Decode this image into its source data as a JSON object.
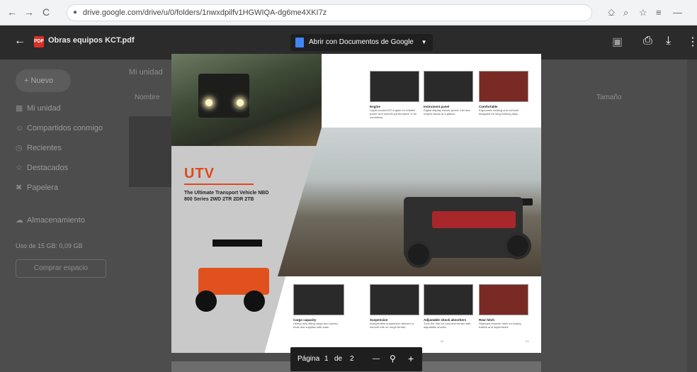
{
  "browser": {
    "back_icon": "←",
    "forward_icon": "→",
    "reload_icon": "C",
    "url": "drive.google.com/drive/u/0/folders/1nwxdpilfv1HGWIQA-dg6me4XKI7z",
    "lock_icon": "lock-icon",
    "extensions": [
      "⎐",
      "⌕",
      "☆",
      "≡",
      "—"
    ]
  },
  "viewer": {
    "file_name": "Obras equipos KCT.pdf",
    "open_with_label": "Abrir con Documentos de Google",
    "back_icon": "←",
    "toolbar_icons": [
      "add-to-drive-icon",
      "print-icon",
      "download-icon",
      "more-icon"
    ]
  },
  "drive": {
    "new_label": "Nuevo",
    "nav_items": [
      {
        "icon": "▦",
        "label": "Mi unidad"
      },
      {
        "icon": "☺",
        "label": "Compartidos conmigo"
      },
      {
        "icon": "◷",
        "label": "Recientes"
      },
      {
        "icon": "☆",
        "label": "Destacados"
      },
      {
        "icon": "✖",
        "label": "Papelera"
      }
    ],
    "storage_label": "Almacenamiento",
    "storage_used": "Uso de 15 GB: 0,09 GB",
    "storage_button": "Comprar espacio",
    "column_header_a": "Mi unidad",
    "column_header_b": "Nombre",
    "column_header_c": "Tamaño"
  },
  "brochure": {
    "title": "UTV",
    "subtitle": "The Ultimate Transport Vehicle NBD 800 Series 2WD 2TR 2DR 2TB",
    "top_captions": [
      {
        "head": "Engine",
        "text": "Liquid-cooled EFI engine for reliable power and smooth performance in all conditions."
      },
      {
        "head": "Instrument panel",
        "text": "Digital display shows speed, fuel and engine status at a glance."
      },
      {
        "head": "Comfortable",
        "text": "Ergonomic seating and controls designed for long working days."
      }
    ],
    "bottom_captions": [
      {
        "head": "Cargo capacity",
        "text": "Heavy-duty tilting cargo bed carries tools and supplies with ease."
      },
      {
        "head": "Suspension",
        "text": "Independent suspension delivers a smooth ride on rough terrain."
      },
      {
        "head": "Adjustable shock absorbers",
        "text": "Tune the ride for load and terrain with adjustable shocks."
      },
      {
        "head": "Rear hitch",
        "text": "Standard receiver hitch for towing trailers and implements."
      }
    ],
    "page_left": "22",
    "page_right": "23"
  },
  "pager": {
    "label": "Página",
    "current": "1",
    "of": "de",
    "total": "2",
    "zoom_out": "—",
    "zoom_icon": "zoom-icon",
    "zoom_in": "+"
  }
}
